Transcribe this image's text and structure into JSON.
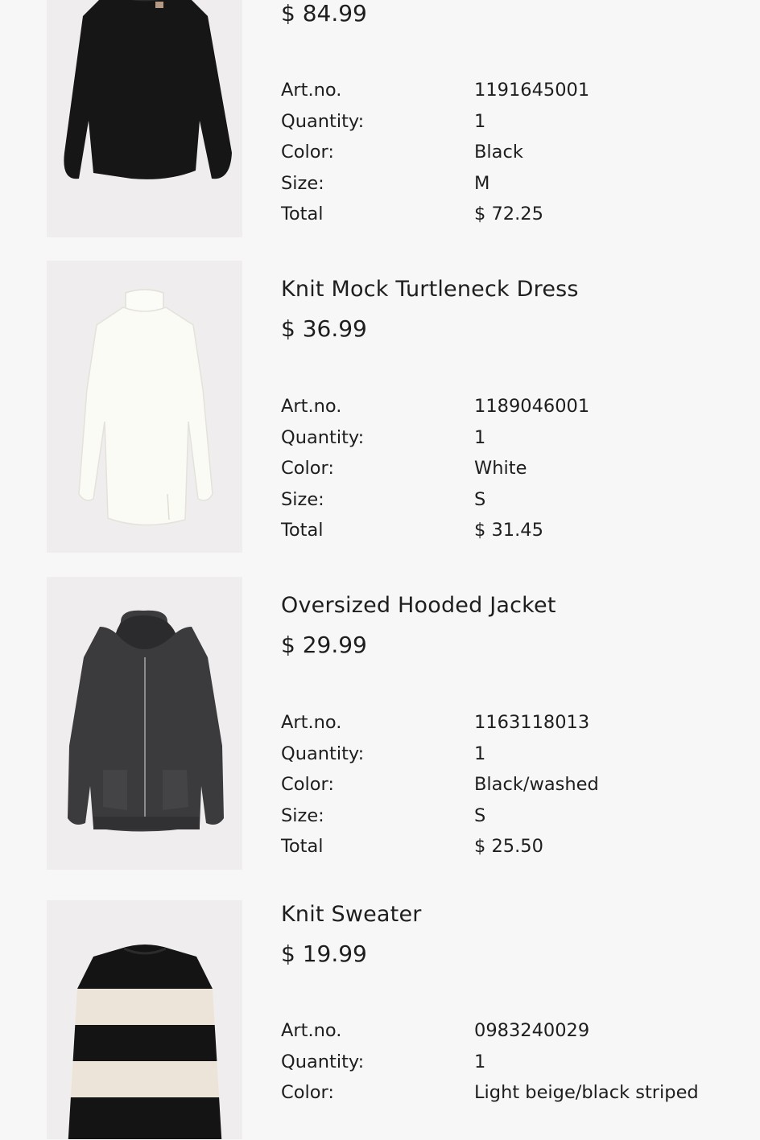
{
  "labels": {
    "art_no": "Art.no.",
    "quantity": "Quantity:",
    "color": "Color:",
    "size": "Size:",
    "total": "Total"
  },
  "items": [
    {
      "name": "",
      "price": "$ 84.99",
      "art_no": "1191645001",
      "quantity": "1",
      "color": "Black",
      "size": "M",
      "total": "$ 72.25",
      "image": "black-fluffy-sweater"
    },
    {
      "name": "Knit Mock Turtleneck Dress",
      "price": "$ 36.99",
      "art_no": "1189046001",
      "quantity": "1",
      "color": "White",
      "size": "S",
      "total": "$ 31.45",
      "image": "white-turtleneck-dress"
    },
    {
      "name": "Oversized Hooded Jacket",
      "price": "$ 29.99",
      "art_no": "1163118013",
      "quantity": "1",
      "color": "Black/washed",
      "size": "S",
      "total": "$ 25.50",
      "image": "black-washed-hooded-jacket"
    },
    {
      "name": "Knit Sweater",
      "price": "$ 19.99",
      "art_no": "0983240029",
      "quantity": "1",
      "color": "Light beige/black striped",
      "image": "striped-knit-sweater"
    }
  ]
}
